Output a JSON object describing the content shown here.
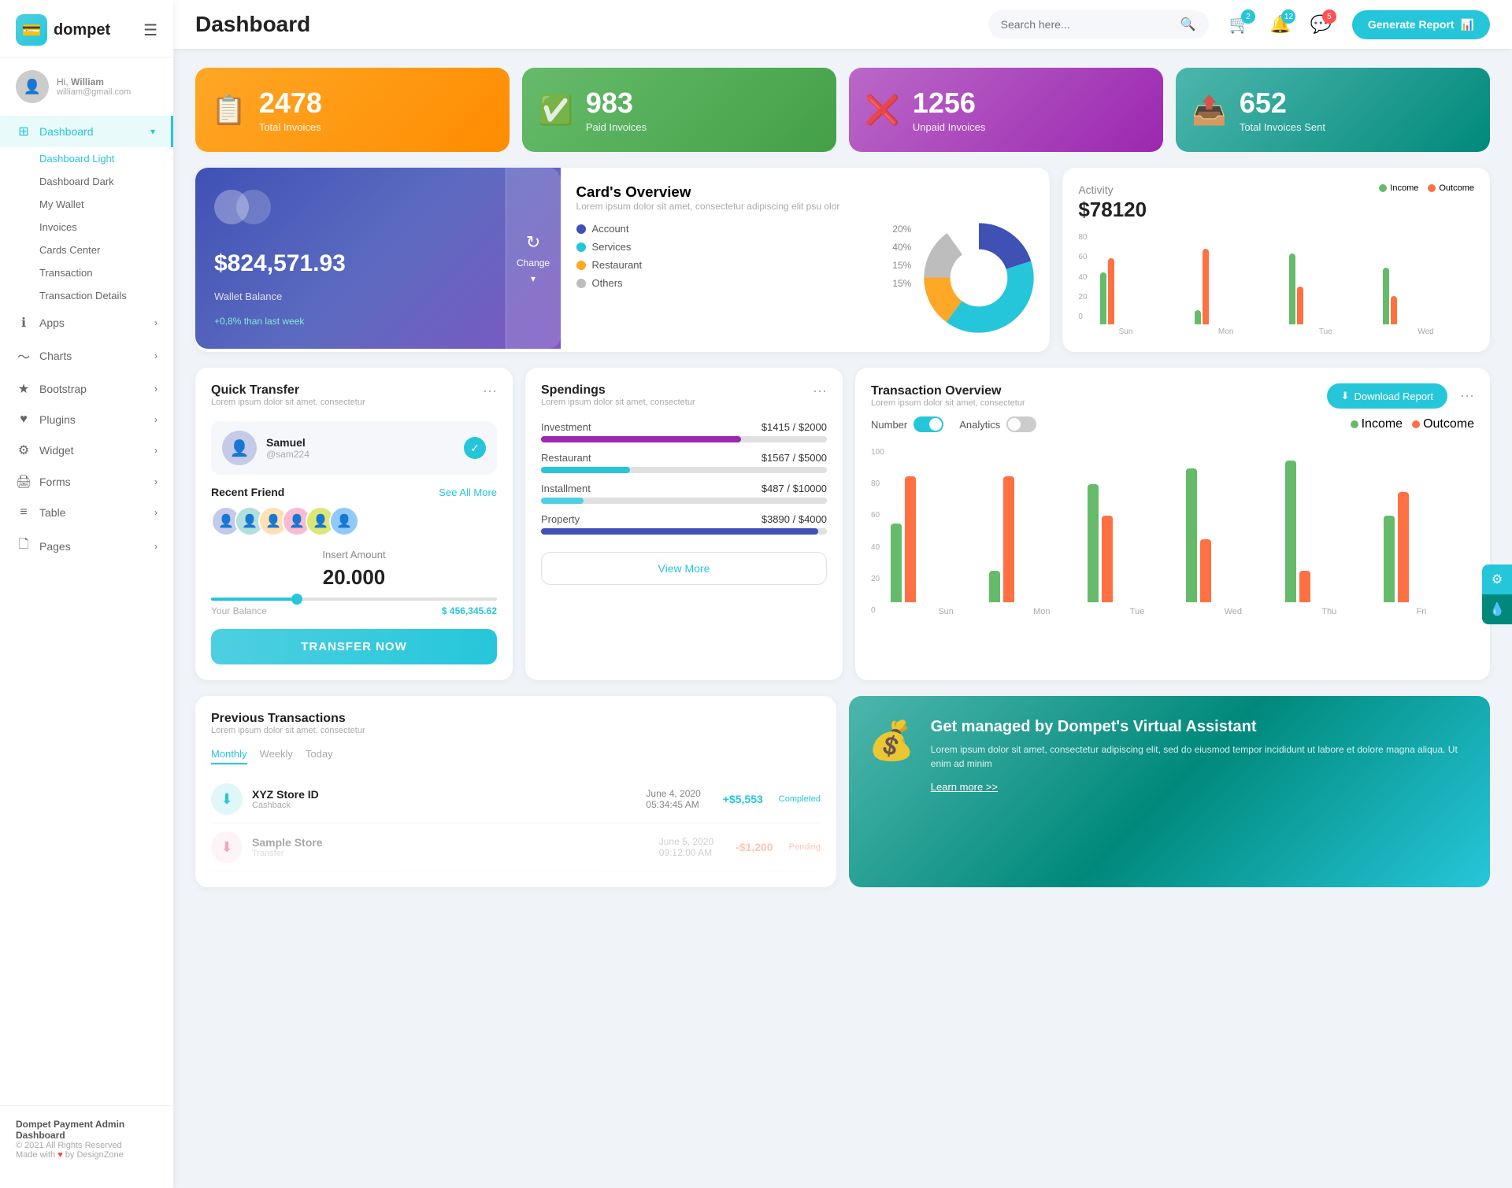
{
  "app": {
    "logo": "💳",
    "name": "dompet",
    "hamburger": "☰"
  },
  "user": {
    "greeting": "Hi,",
    "name": "William",
    "email": "william@gmail.com",
    "avatar": "👤"
  },
  "sidebar": {
    "items": [
      {
        "id": "dashboard",
        "label": "Dashboard",
        "icon": "⊞",
        "active": true,
        "arrow": "▾"
      },
      {
        "id": "apps",
        "label": "Apps",
        "icon": "ℹ",
        "arrow": "›"
      },
      {
        "id": "charts",
        "label": "Charts",
        "icon": "〜",
        "arrow": "›"
      },
      {
        "id": "bootstrap",
        "label": "Bootstrap",
        "icon": "★",
        "arrow": "›"
      },
      {
        "id": "plugins",
        "label": "Plugins",
        "icon": "♥",
        "arrow": "›"
      },
      {
        "id": "widget",
        "label": "Widget",
        "icon": "⚙",
        "arrow": "›"
      },
      {
        "id": "forms",
        "label": "Forms",
        "icon": "🖨",
        "arrow": "›"
      },
      {
        "id": "table",
        "label": "Table",
        "icon": "≡",
        "arrow": "›"
      },
      {
        "id": "pages",
        "label": "Pages",
        "icon": "🗋",
        "arrow": "›"
      }
    ],
    "sub_items": [
      {
        "id": "dashboard-light",
        "label": "Dashboard Light",
        "active": true
      },
      {
        "id": "dashboard-dark",
        "label": "Dashboard Dark"
      },
      {
        "id": "my-wallet",
        "label": "My Wallet"
      },
      {
        "id": "invoices",
        "label": "Invoices"
      },
      {
        "id": "cards-center",
        "label": "Cards Center"
      },
      {
        "id": "transaction",
        "label": "Transaction"
      },
      {
        "id": "transaction-details",
        "label": "Transaction Details"
      }
    ],
    "footer": {
      "brand": "Dompet Payment Admin Dashboard",
      "year": "© 2021 All Rights Reserved",
      "made": "Made with",
      "by": "by DesignZone"
    }
  },
  "header": {
    "title": "Dashboard",
    "search_placeholder": "Search here...",
    "generate_btn": "Generate Report",
    "bell_badge": "12",
    "cart_badge": "2",
    "msg_badge": "5"
  },
  "stats": [
    {
      "id": "total-invoices",
      "number": "2478",
      "label": "Total Invoices",
      "icon": "📋",
      "color": "orange"
    },
    {
      "id": "paid-invoices",
      "number": "983",
      "label": "Paid Invoices",
      "icon": "✅",
      "color": "green"
    },
    {
      "id": "unpaid-invoices",
      "number": "1256",
      "label": "Unpaid Invoices",
      "icon": "❌",
      "color": "purple"
    },
    {
      "id": "total-sent",
      "number": "652",
      "label": "Total Invoices Sent",
      "icon": "📤",
      "color": "teal-dark"
    }
  ],
  "wallet": {
    "circles": [
      "●",
      "●"
    ],
    "amount": "$824,571.93",
    "label": "Wallet Balance",
    "change": "+0,8% than last week",
    "change_btn": "Change",
    "refresh_icon": "↻"
  },
  "cards_overview": {
    "title": "Card's Overview",
    "subtitle": "Lorem ipsum dolor sit amet, consectetur adipiscing elit psu olor",
    "legend": [
      {
        "id": "account",
        "label": "Account",
        "pct": "20%",
        "color": "#3f51b5"
      },
      {
        "id": "services",
        "label": "Services",
        "pct": "40%",
        "color": "#26c6da"
      },
      {
        "id": "restaurant",
        "label": "Restaurant",
        "pct": "15%",
        "color": "#ffa726"
      },
      {
        "id": "others",
        "label": "Others",
        "pct": "15%",
        "color": "#bdbdbd"
      }
    ]
  },
  "activity": {
    "title": "Activity",
    "amount": "$78120",
    "legend": [
      {
        "label": "Income",
        "color": "#66bb6a"
      },
      {
        "label": "Outcome",
        "color": "#ff7043"
      }
    ],
    "bars": [
      {
        "day": "Sun",
        "income": 55,
        "outcome": 70
      },
      {
        "day": "Mon",
        "income": 15,
        "outcome": 80
      },
      {
        "day": "Tue",
        "income": 75,
        "outcome": 40
      },
      {
        "day": "Wed",
        "income": 60,
        "outcome": 30
      }
    ],
    "y_labels": [
      "0",
      "20",
      "40",
      "60",
      "80"
    ]
  },
  "quick_transfer": {
    "title": "Quick Transfer",
    "subtitle": "Lorem ipsum dolor sit amet, consectetur",
    "contact": {
      "name": "Samuel",
      "handle": "@sam224",
      "avatar": "👤"
    },
    "friends_label": "Recent Friend",
    "see_all": "See All More",
    "friends": [
      "👤",
      "👤",
      "👤",
      "👤",
      "👤",
      "👤"
    ],
    "amount_label": "Insert Amount",
    "amount_value": "20.000",
    "balance_label": "Your Balance",
    "balance_value": "$ 456,345.62",
    "transfer_btn": "TRANSFER NOW"
  },
  "spendings": {
    "title": "Spendings",
    "subtitle": "Lorem ipsum dolor sit amet, consectetur",
    "items": [
      {
        "id": "investment",
        "name": "Investment",
        "current": "$1415",
        "max": "$2000",
        "pct": 70,
        "color": "#9c27b0"
      },
      {
        "id": "restaurant",
        "name": "Restaurant",
        "current": "$1567",
        "max": "$5000",
        "pct": 31,
        "color": "#26c6da"
      },
      {
        "id": "installment",
        "name": "Installment",
        "current": "$487",
        "max": "$10000",
        "pct": 15,
        "color": "#4dd0e1"
      },
      {
        "id": "property",
        "name": "Property",
        "current": "$3890",
        "max": "$4000",
        "pct": 97,
        "color": "#3f51b5"
      }
    ],
    "view_more": "View More"
  },
  "transaction_overview": {
    "title": "Transaction Overview",
    "subtitle": "Lorem ipsum dolor sit amet, consectetur",
    "download_btn": "Download Report",
    "toggle_number": "Number",
    "toggle_analytics": "Analytics",
    "legend": [
      {
        "label": "Income",
        "color": "#66bb6a"
      },
      {
        "label": "Outcome",
        "color": "#ff7043"
      }
    ],
    "bars": [
      {
        "day": "Sun",
        "income": 50,
        "outcome": 80
      },
      {
        "day": "Mon",
        "income": 20,
        "outcome": 80
      },
      {
        "day": "Tue",
        "income": 75,
        "outcome": 55
      },
      {
        "day": "Wed",
        "income": 85,
        "outcome": 40
      },
      {
        "day": "Thu",
        "income": 90,
        "outcome": 20
      },
      {
        "day": "Fri",
        "income": 55,
        "outcome": 70
      }
    ],
    "y_labels": [
      "0",
      "20",
      "40",
      "60",
      "80",
      "100"
    ]
  },
  "previous_transactions": {
    "title": "Previous Transactions",
    "subtitle": "Lorem ipsum dolor sit amet, consectetur",
    "tabs": [
      "Monthly",
      "Weekly",
      "Today"
    ],
    "active_tab": "Monthly",
    "transactions": [
      {
        "id": "t1",
        "icon": "⬇",
        "name": "XYZ Store ID",
        "type": "Cashback",
        "date": "June 4, 2020",
        "time": "05:34:45 AM",
        "amount": "+$5,553",
        "status": "Completed"
      }
    ]
  },
  "virtual_assistant": {
    "icon": "💰",
    "title": "Get managed by Dompet's Virtual Assistant",
    "description": "Lorem ipsum dolor sit amet, consectetur adipiscing elit, sed do eiusmod tempor incididunt ut labore et dolore magna aliqua. Ut enim ad minim",
    "link": "Learn more >>"
  },
  "float_buttons": [
    {
      "id": "settings",
      "icon": "⚙"
    },
    {
      "id": "water",
      "icon": "💧"
    }
  ]
}
